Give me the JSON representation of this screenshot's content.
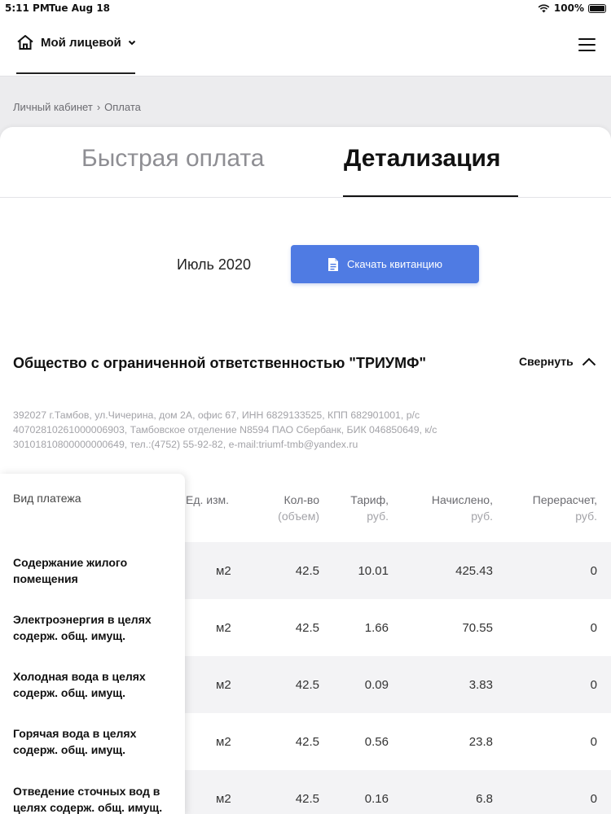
{
  "status_bar": {
    "time": "5:11 PM",
    "date": "Tue Aug 18",
    "battery": "100%"
  },
  "header": {
    "account_label": "Мой лицевой"
  },
  "breadcrumb": {
    "home": "Личный кабинет",
    "separator": "›",
    "current": "Оплата"
  },
  "tabs": {
    "fast_payment": "Быстрая оплата",
    "details": "Детализация",
    "active": "details"
  },
  "period": {
    "month": "Июль 2020",
    "download_label": "Скачать квитанцию"
  },
  "provider": {
    "name": "Общество с ограниченной ответственностью \"ТРИУМФ\"",
    "collapse_label": "Свернуть",
    "requisites": "392027 г.Тамбов, ул.Чичерина, дом 2А, офис 67, ИНН 6829133525, КПП 682901001, р/с 40702810261000006903, Тамбовское отделение N8594 ПАО Сбербанк, БИК 046850649, к/с 30101810800000000649, тел.:(4752) 55-92-82, e-mail:triumf-tmb@yandex.ru"
  },
  "table": {
    "headers": {
      "payment_type": "Вид платежа",
      "unit": "Ед. изм.",
      "qty": "Кол-во",
      "qty_sub": "(объем)",
      "tariff": "Тариф,",
      "tariff_sub": "руб.",
      "charged": "Начислено,",
      "charged_sub": "руб.",
      "recalc": "Перерасчет,",
      "recalc_sub": "руб."
    },
    "rows": [
      {
        "name": "Содержание жилого помещения",
        "unit": "м2",
        "qty": "42.5",
        "tariff": "10.01",
        "charged": "425.43",
        "recalc": "0"
      },
      {
        "name": "Электроэнергия в целях содерж. общ. имущ.",
        "unit": "м2",
        "qty": "42.5",
        "tariff": "1.66",
        "charged": "70.55",
        "recalc": "0"
      },
      {
        "name": "Холодная вода в целях содерж. общ. имущ.",
        "unit": "м2",
        "qty": "42.5",
        "tariff": "0.09",
        "charged": "3.83",
        "recalc": "0"
      },
      {
        "name": "Горячая вода в целях содерж. общ. имущ.",
        "unit": "м2",
        "qty": "42.5",
        "tariff": "0.56",
        "charged": "23.8",
        "recalc": "0"
      },
      {
        "name": "Отведение сточных вод в целях содерж. общ. имущ.",
        "unit": "м2",
        "qty": "42.5",
        "tariff": "0.16",
        "charged": "6.8",
        "recalc": "0"
      }
    ]
  },
  "colors": {
    "accent": "#4f7be3",
    "row_shade": "#f3f3f5",
    "muted_text": "#a3a3a8"
  },
  "icons": [
    "wifi-icon",
    "battery-icon",
    "home-icon",
    "chevron-down-icon",
    "menu-icon",
    "document-icon",
    "chevron-up-icon"
  ]
}
